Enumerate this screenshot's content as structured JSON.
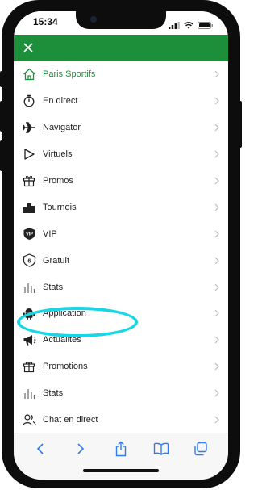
{
  "status_bar": {
    "time": "15:34"
  },
  "menu": {
    "items": [
      {
        "label": "Paris Sportifs",
        "icon": "home-icon",
        "active": true
      },
      {
        "label": "En direct",
        "icon": "stopwatch-icon"
      },
      {
        "label": "Navigator",
        "icon": "airplane-icon"
      },
      {
        "label": "Virtuels",
        "icon": "play-icon"
      },
      {
        "label": "Promos",
        "icon": "gift-icon"
      },
      {
        "label": "Tournois",
        "icon": "podium-icon"
      },
      {
        "label": "VIP",
        "icon": "vip-badge-icon"
      },
      {
        "label": "Gratuit",
        "icon": "six-shield-icon"
      },
      {
        "label": "Stats",
        "icon": "bar-chart-icon"
      },
      {
        "label": "Application",
        "icon": "android-icon"
      },
      {
        "label": "Actualités",
        "icon": "megaphone-icon"
      },
      {
        "label": "Promotions",
        "icon": "gift-icon"
      },
      {
        "label": "Stats",
        "icon": "bar-chart-icon"
      },
      {
        "label": "Chat en direct",
        "icon": "users-icon"
      }
    ]
  },
  "colors": {
    "brand_green": "#1d8f3b",
    "highlight_cyan": "#17d7e6",
    "ios_blue": "#2f7bf5"
  },
  "browser_toolbar": {
    "icons": [
      "back-icon",
      "forward-icon",
      "share-icon",
      "bookmarks-icon",
      "tabs-icon"
    ]
  }
}
